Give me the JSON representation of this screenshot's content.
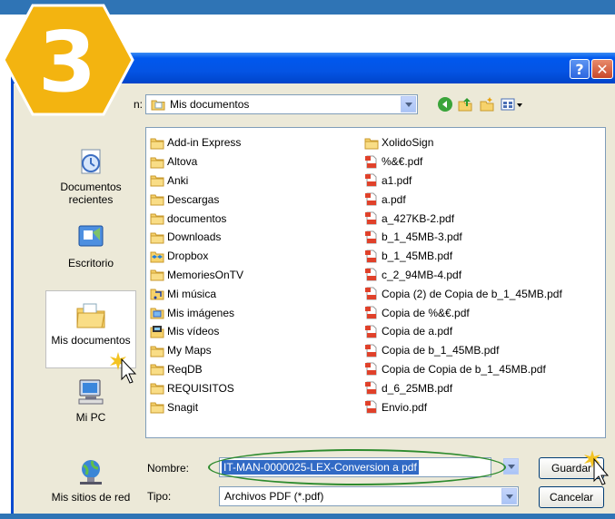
{
  "colors": {
    "titlebar": "#0454e4",
    "dialog_bg": "#ece9d8",
    "badge": "#f3b410",
    "highlight_oval": "#2e8b2e"
  },
  "badge": {
    "number": "3"
  },
  "titlebar": {
    "help_label": "?",
    "close_label": "✕"
  },
  "location": {
    "label": "n:",
    "value": "Mis documentos"
  },
  "toolbar_icons": [
    "back-icon",
    "up-folder-icon",
    "new-folder-icon",
    "view-menu-icon"
  ],
  "places": [
    {
      "label": "Documentos\nrecientes",
      "icon": "recent-documents-icon"
    },
    {
      "label": "Escritorio",
      "icon": "desktop-icon"
    },
    {
      "label": "Mis documentos",
      "icon": "my-documents-icon"
    },
    {
      "label": "Mi PC",
      "icon": "my-computer-icon"
    },
    {
      "label": "Mis sitios de red",
      "icon": "network-places-icon"
    }
  ],
  "files_col1": [
    {
      "name": "Add-in Express",
      "type": "folder"
    },
    {
      "name": "Altova",
      "type": "folder"
    },
    {
      "name": "Anki",
      "type": "folder"
    },
    {
      "name": "Descargas",
      "type": "folder"
    },
    {
      "name": "documentos",
      "type": "folder"
    },
    {
      "name": "Downloads",
      "type": "folder"
    },
    {
      "name": "Dropbox",
      "type": "dropbox"
    },
    {
      "name": "MemoriesOnTV",
      "type": "folder"
    },
    {
      "name": "Mi música",
      "type": "music"
    },
    {
      "name": "Mis imágenes",
      "type": "pictures"
    },
    {
      "name": "Mis vídeos",
      "type": "videos"
    },
    {
      "name": "My Maps",
      "type": "folder"
    },
    {
      "name": "ReqDB",
      "type": "folder"
    },
    {
      "name": "REQUISITOS",
      "type": "folder"
    },
    {
      "name": "Snagit",
      "type": "folder"
    }
  ],
  "files_col2": [
    {
      "name": "XolidoSign",
      "type": "folder"
    },
    {
      "name": "%&€.pdf",
      "type": "pdf"
    },
    {
      "name": "a1.pdf",
      "type": "pdf"
    },
    {
      "name": "a.pdf",
      "type": "pdf"
    },
    {
      "name": "a_427KB-2.pdf",
      "type": "pdf"
    },
    {
      "name": "b_1_45MB-3.pdf",
      "type": "pdf"
    },
    {
      "name": "b_1_45MB.pdf",
      "type": "pdf"
    },
    {
      "name": "c_2_94MB-4.pdf",
      "type": "pdf"
    },
    {
      "name": "Copia (2) de Copia de b_1_45MB.pdf",
      "type": "pdf"
    },
    {
      "name": "Copia de %&€.pdf",
      "type": "pdf"
    },
    {
      "name": "Copia de a.pdf",
      "type": "pdf"
    },
    {
      "name": "Copia de b_1_45MB.pdf",
      "type": "pdf"
    },
    {
      "name": "Copia de Copia de b_1_45MB.pdf",
      "type": "pdf"
    },
    {
      "name": "d_6_25MB.pdf",
      "type": "pdf"
    },
    {
      "name": "Envio.pdf",
      "type": "pdf"
    }
  ],
  "form": {
    "name_label": "Nombre:",
    "name_value": "IT-MAN-0000025-LEX-Conversion a pdf",
    "type_label": "Tipo:",
    "type_value": "Archivos PDF (*.pdf)"
  },
  "buttons": {
    "save": "Guardar",
    "cancel": "Cancelar"
  }
}
